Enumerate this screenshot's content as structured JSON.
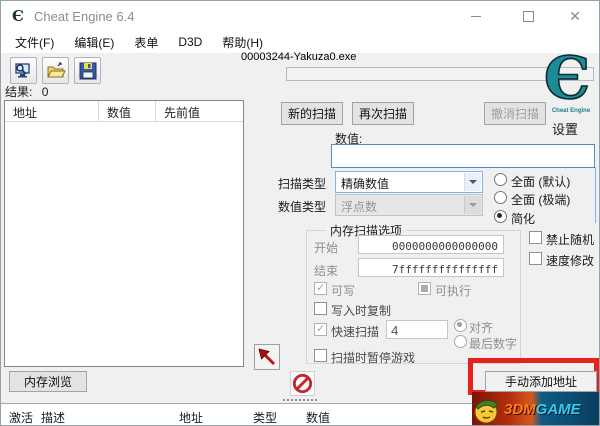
{
  "window": {
    "title": "Cheat Engine 6.4",
    "process_name": "00003244-Yakuza0.exe"
  },
  "menu": {
    "items": [
      {
        "label": "文件(F)"
      },
      {
        "label": "编辑(E)"
      },
      {
        "label": "表单"
      },
      {
        "label": "D3D"
      },
      {
        "label": "帮助(H)"
      }
    ]
  },
  "results": {
    "label": "结果:",
    "count": "0"
  },
  "found_list": {
    "columns": [
      "地址",
      "数值",
      "先前值"
    ]
  },
  "scan": {
    "new_scan": "新的扫描",
    "next_scan": "再次扫描",
    "undo_scan": "撤消扫描",
    "settings_label": "设置",
    "value_label": "数值:",
    "value": "",
    "scan_type_label": "扫描类型",
    "scan_type_value": "精确数值",
    "value_type_label": "数值类型",
    "value_type_value": "浮点数",
    "scan_modes": [
      {
        "label": "全面 (默认)",
        "selected": false
      },
      {
        "label": "全面 (极端)",
        "selected": false
      },
      {
        "label": "简化",
        "selected": true
      }
    ]
  },
  "memory_options": {
    "title": "内存扫描选项",
    "start_label": "开始",
    "start_value": "0000000000000000",
    "stop_label": "结束",
    "stop_value": "7fffffffffffffff",
    "writable_label": "可写",
    "executable_label": "可执行",
    "copy_on_write_label": "写入时复制",
    "fast_scan_label": "快速扫描",
    "fast_scan_value": "4",
    "aligned_label": "对齐",
    "last_digits_label": "最后数字",
    "pause_game_label": "扫描时暂停游戏"
  },
  "side_options": {
    "no_random_label": "禁止随机",
    "speed_hack_label": "速度修改"
  },
  "footer": {
    "memory_view": "内存浏览",
    "add_address": "手动添加地址",
    "columns": [
      "激活",
      "描述",
      "地址",
      "类型",
      "数值"
    ]
  },
  "logo": {
    "caption": "Cheat Engine"
  },
  "watermark": {
    "part1": "3DM",
    "part2": "GAME"
  },
  "colors": {
    "accent_blue": "#7eb4ea",
    "focus_blue": "#4a90c4",
    "highlight_red": "#e5231b",
    "logo_teal": "#1d8a96"
  }
}
